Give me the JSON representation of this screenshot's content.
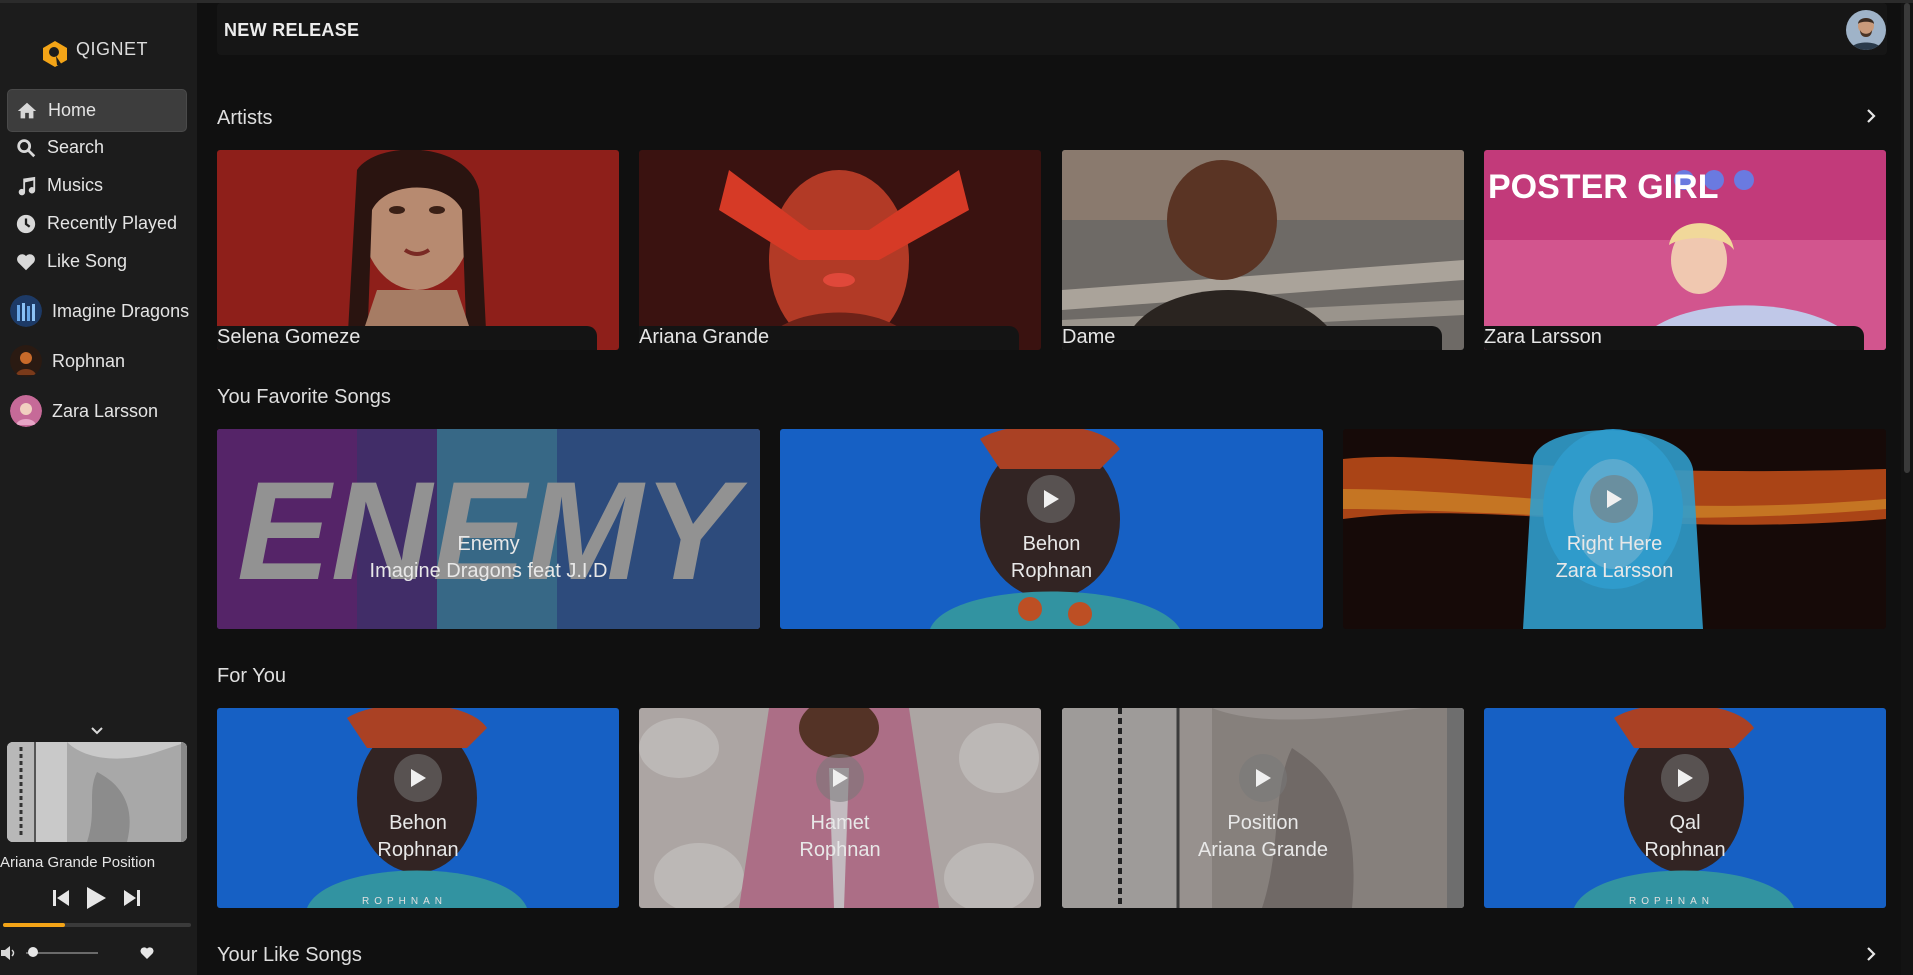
{
  "app": {
    "name": "QIGNET",
    "brand_color": "#f3a417"
  },
  "nav": [
    {
      "label": "Home",
      "icon": "home-icon",
      "active": true
    },
    {
      "label": "Search",
      "icon": "search-icon"
    },
    {
      "label": "Musics",
      "icon": "music-note-icon"
    },
    {
      "label": "Recently Played",
      "icon": "clock-icon"
    },
    {
      "label": "Like Song",
      "icon": "heart-icon"
    }
  ],
  "playlists": [
    {
      "label": "Imagine Dragons"
    },
    {
      "label": "Rophnan"
    },
    {
      "label": "Zara Larsson"
    }
  ],
  "now_playing": {
    "title": "Ariana Grande Position",
    "progress": 0.33,
    "volume": 0.05
  },
  "header": {
    "title": "NEW RELEASE"
  },
  "sections": {
    "artists": {
      "title": "Artists",
      "items": [
        {
          "name": "Selena Gomeze"
        },
        {
          "name": "Ariana Grande"
        },
        {
          "name": "Dame"
        },
        {
          "name": "Zara Larsson"
        }
      ]
    },
    "favorites": {
      "title": "You Favorite Songs",
      "items": [
        {
          "title": "Enemy",
          "artist": "Imagine Dragons feat J.I.D",
          "cover_text": "ENEMY"
        },
        {
          "title": "Behon",
          "artist": "Rophnan"
        },
        {
          "title": "Right Here",
          "artist": "Zara Larsson"
        }
      ]
    },
    "for_you": {
      "title": "For You",
      "items": [
        {
          "title": "Behon",
          "artist": "Rophnan",
          "cover_text": "ROPHNAN"
        },
        {
          "title": "Hamet",
          "artist": "Rophnan"
        },
        {
          "title": "Position",
          "artist": "Ariana Grande"
        },
        {
          "title": "Qal",
          "artist": "Rophnan",
          "cover_text": "ROPHNAN"
        }
      ]
    },
    "liked": {
      "title": "Your Like Songs"
    }
  },
  "poster_text": "POSTER GIRL"
}
